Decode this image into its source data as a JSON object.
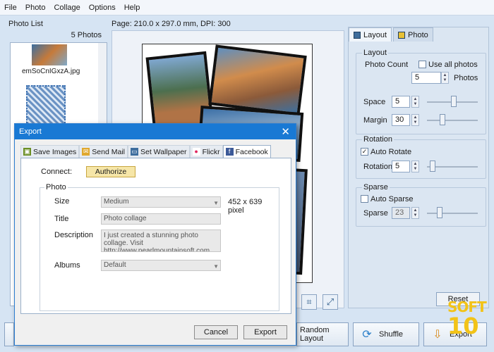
{
  "menu": [
    "File",
    "Photo",
    "Collage",
    "Options",
    "Help"
  ],
  "photo_list": {
    "title": "Photo List",
    "count": "5 Photos",
    "items": [
      {
        "name": "emSoCnIGxzA.jpg"
      }
    ]
  },
  "page_info": "Page: 210.0 x 297.0 mm, DPI: 300",
  "right_panel": {
    "tabs": [
      {
        "label": "Layout"
      },
      {
        "label": "Photo"
      }
    ],
    "layout": {
      "title": "Layout",
      "photo_count_label": "Photo Count",
      "use_all_label": "Use all photos",
      "photo_count_value": "5",
      "photos_suffix": "Photos",
      "space_label": "Space",
      "space_value": "5",
      "margin_label": "Margin",
      "margin_value": "30"
    },
    "rotation": {
      "title": "Rotation",
      "auto_label": "Auto Rotate",
      "rotation_label": "Rotation",
      "rotation_value": "5"
    },
    "sparse": {
      "title": "Sparse",
      "auto_label": "Auto Sparse",
      "sparse_label": "Sparse",
      "sparse_value": "23"
    },
    "reset": "Reset"
  },
  "bottom": {
    "random_layout": "Random Layout",
    "shuffle": "Shuffle",
    "export": "Export"
  },
  "watermark": {
    "line1": "SOFT",
    "line2": "10"
  },
  "dialog": {
    "title": "Export",
    "tabs": [
      {
        "label": "Save Images"
      },
      {
        "label": "Send Mail"
      },
      {
        "label": "Set Wallpaper"
      },
      {
        "label": "Flickr"
      },
      {
        "label": "Facebook"
      }
    ],
    "connect_label": "Connect:",
    "authorize": "Authorize",
    "photo_group": "Photo",
    "size_label": "Size",
    "size_value": "Medium",
    "size_pixels": "452 x 639 pixel",
    "title_label": "Title",
    "title_value": "Photo collage",
    "description_label": "Description",
    "description_value": "I just created a stunning photo collage. Visit http://www.pearlmountainsoft.com",
    "albums_label": "Albums",
    "albums_value": "Default",
    "cancel": "Cancel",
    "export": "Export"
  }
}
